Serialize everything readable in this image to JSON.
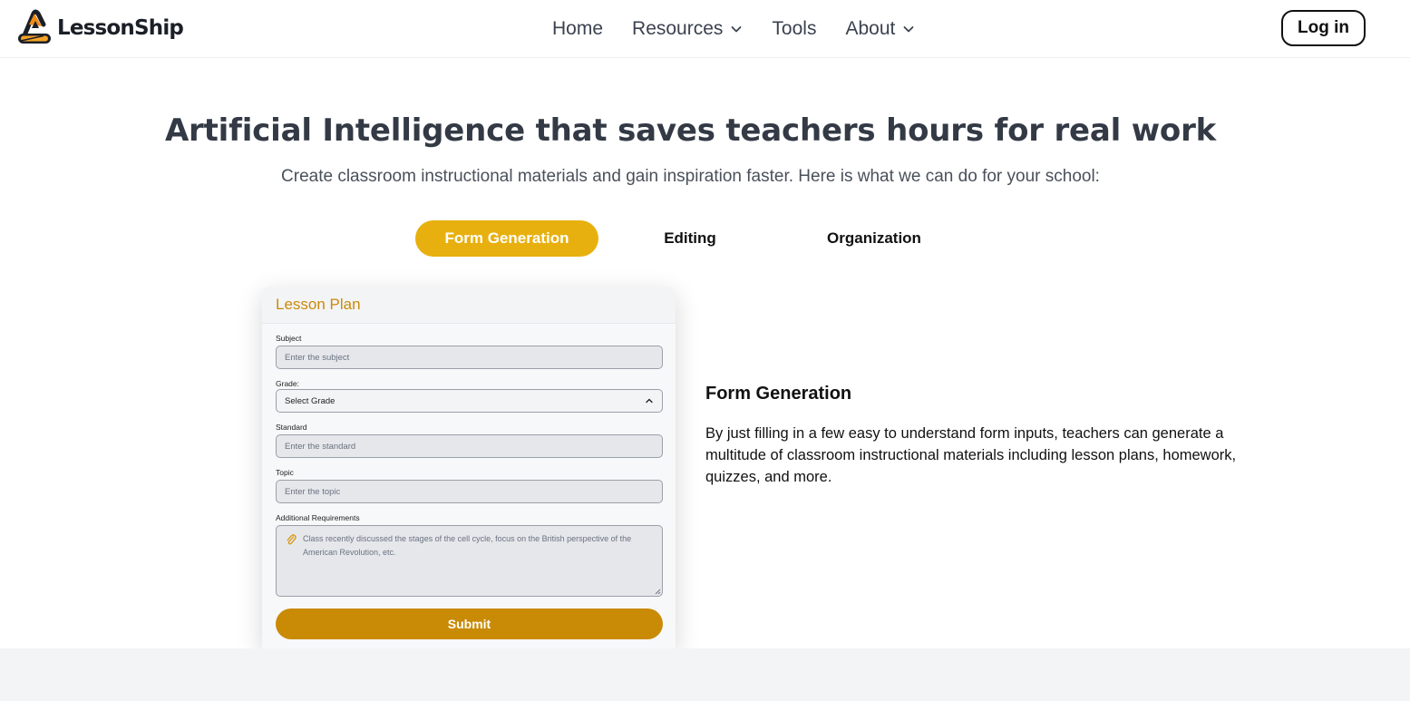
{
  "brand": {
    "name": "LessonShip",
    "logo_icon": "lessonship-logo-icon",
    "accent": "#e8b00f"
  },
  "nav": {
    "items": [
      {
        "label": "Home",
        "has_dropdown": false
      },
      {
        "label": "Resources",
        "has_dropdown": true
      },
      {
        "label": "Tools",
        "has_dropdown": false
      },
      {
        "label": "About",
        "has_dropdown": true
      }
    ],
    "login_label": "Log in"
  },
  "hero": {
    "title": "Artificial Intelligence that saves teachers hours for real work",
    "subtitle": "Create classroom instructional materials and gain inspiration faster. Here is what we can do for your school:"
  },
  "tabs": [
    {
      "label": "Form Generation",
      "active": true
    },
    {
      "label": "Editing",
      "active": false
    },
    {
      "label": "Organization",
      "active": false
    }
  ],
  "form_card": {
    "title": "Lesson Plan",
    "subject": {
      "label": "Subject",
      "placeholder": "Enter the subject"
    },
    "grade": {
      "label": "Grade:",
      "value": "Select Grade"
    },
    "standard": {
      "label": "Standard",
      "placeholder": "Enter the standard"
    },
    "topic": {
      "label": "Topic",
      "placeholder": "Enter the topic"
    },
    "additional": {
      "label": "Additional Requirements",
      "placeholder": "Class recently discussed the stages of the cell cycle, focus on the British perspective of the American Revolution, etc."
    },
    "submit_label": "Submit",
    "title_color": "#c98a0a",
    "submit_color": "#c98a06"
  },
  "feature": {
    "title": "Form Generation",
    "description": "By just filling in a few easy to understand form inputs, teachers can generate a multitude of classroom instructional materials including lesson plans, homework, quizzes, and more."
  }
}
